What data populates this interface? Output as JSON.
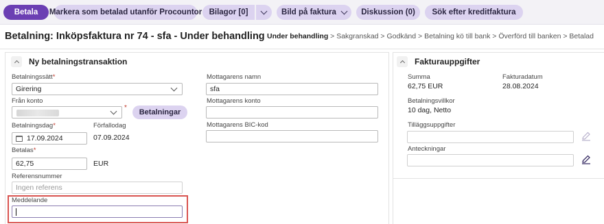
{
  "toolbar": {
    "betala": "Betala",
    "markera": "Markera som betalad utanför Procountor",
    "bilagor": "Bilagor [0]",
    "bild": "Bild på faktura",
    "diskussion": "Diskussion (0)",
    "sok": "Sök efter kreditfaktura"
  },
  "header": {
    "title": "Betalning: Inköpsfaktura nr 74 - sfa - Under behandling",
    "breadcrumb": [
      "Under behandling",
      "Sakgranskad",
      "Godkänd",
      "Betalning kö till bank",
      "Överförd till banken",
      "Betalad"
    ],
    "separator": " > "
  },
  "payment": {
    "section_title": "Ny betalningstransaktion",
    "betalningssatt_label": "Betalningssätt",
    "betalningssatt_value": "Girering",
    "fran_konto_label": "Från konto",
    "betalningar_button": "Betalningar",
    "betalningsdag_label": "Betalningsdag",
    "betalningsdag_value": "17.09.2024",
    "forfallodag_label": "Förfallodag",
    "forfallodag_value": "07.09.2024",
    "betalas_label": "Betalas",
    "betalas_value": "62,75",
    "currency": "EUR",
    "referensnummer_label": "Referensnummer",
    "referensnummer_placeholder": "Ingen referens",
    "meddelande_label": "Meddelande",
    "mottagarens_namn_label": "Mottagarens namn",
    "mottagarens_namn_value": "sfa",
    "mottagarens_konto_label": "Mottagarens konto",
    "mottagarens_bic_label": "Mottagarens BIC-kod",
    "required_mark": "*"
  },
  "invoice": {
    "section_title": "Fakturauppgifter",
    "summa_label": "Summa",
    "summa_value": "62,75 EUR",
    "fakturadatum_label": "Fakturadatum",
    "fakturadatum_value": "28.08.2024",
    "villkor_label": "Betalningsvillkor",
    "villkor_value": "10 dag, Netto",
    "tillagg_label": "Tilläggsuppgifter",
    "anteckningar_label": "Anteckningar"
  },
  "colors": {
    "primary": "#6b3fb3",
    "pill": "#dcd3f0",
    "highlight": "#d9534f"
  }
}
